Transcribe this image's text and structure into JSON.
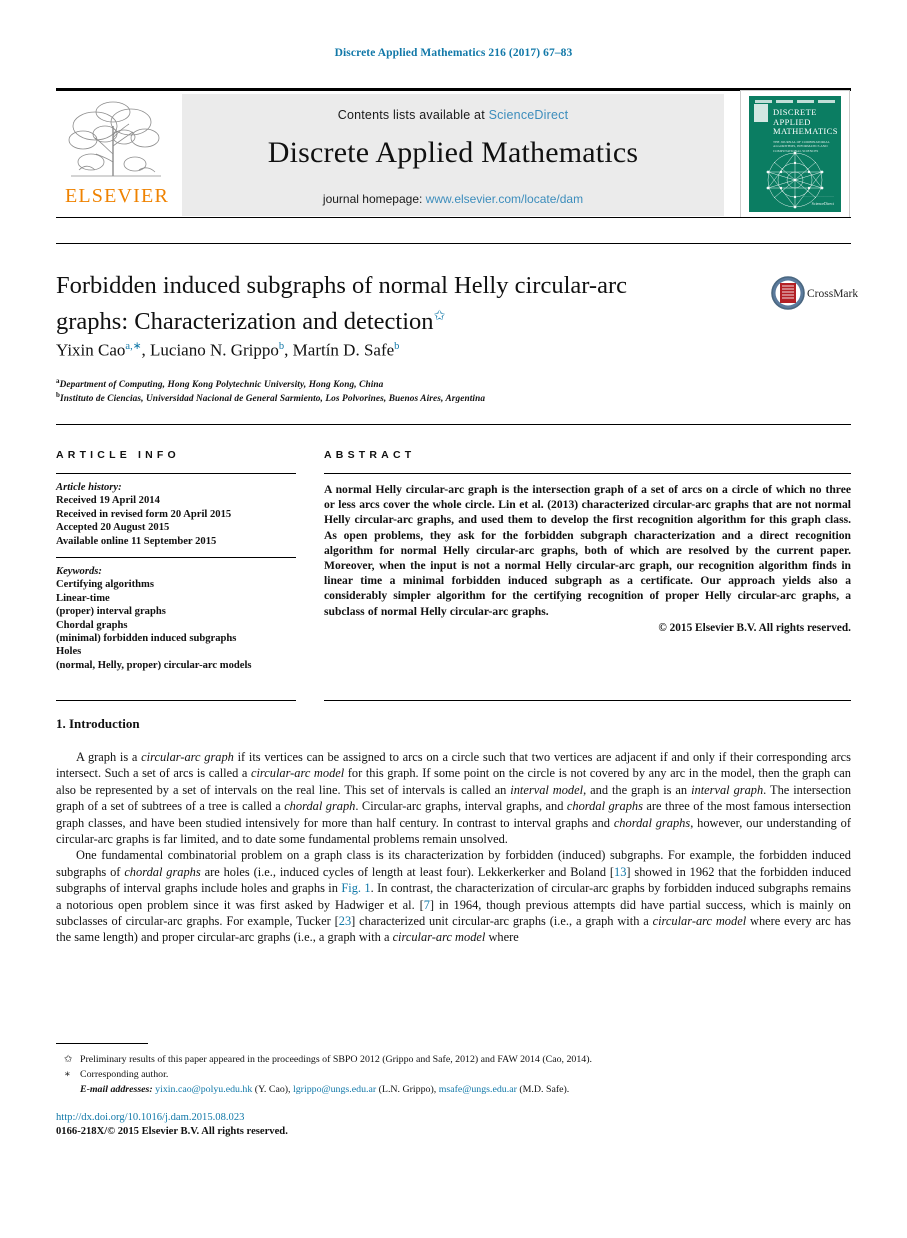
{
  "running_head": "Discrete Applied Mathematics 216 (2017) 67–83",
  "masthead": {
    "contents_prefix": "Contents lists available at",
    "contents_link": "ScienceDirect",
    "journal_title": "Discrete Applied Mathematics",
    "homepage_prefix": "journal homepage:",
    "homepage_url": "www.elsevier.com/locate/dam",
    "publisher_wordmark": "ELSEVIER",
    "cover": {
      "title_lines": [
        "DISCRETE",
        "APPLIED",
        "MATHEMATICS"
      ],
      "subtitle": "THE JOURNAL OF COMBINATORIAL ALGORITHMS, INFORMATICS AND COMPUTATIONAL SCIENCES",
      "footer": "ScienceDirect",
      "color": "#0b7d62"
    }
  },
  "article": {
    "title_line1": "Forbidden induced subgraphs of normal Helly circular-arc",
    "title_line2": "graphs: Characterization and detection",
    "title_marker": "✩",
    "crossmark_label": "CrossMark",
    "authors": [
      {
        "name": "Yixin Cao",
        "marks": "a,∗"
      },
      {
        "name": "Luciano N. Grippo",
        "marks": "b"
      },
      {
        "name": "Martín D. Safe",
        "marks": "b"
      }
    ],
    "affiliations": [
      {
        "mark": "a",
        "text": "Department of Computing, Hong Kong Polytechnic University, Hong Kong, China"
      },
      {
        "mark": "b",
        "text": "Instituto de Ciencias, Universidad Nacional de General Sarmiento, Los Polvorines, Buenos Aires, Argentina"
      }
    ]
  },
  "info": {
    "heading": "ARTICLE INFO",
    "history_label": "Article history:",
    "history": [
      "Received 19 April 2014",
      "Received in revised form 20 April 2015",
      "Accepted 20 August 2015",
      "Available online 11 September 2015"
    ],
    "keywords_label": "Keywords:",
    "keywords": [
      "Certifying algorithms",
      "Linear-time",
      "(proper) interval graphs",
      "Chordal graphs",
      "(minimal) forbidden induced subgraphs",
      "Holes",
      "(normal, Helly, proper) circular-arc models"
    ]
  },
  "abstract": {
    "heading": "ABSTRACT",
    "body": "A normal Helly circular-arc graph is the intersection graph of a set of arcs on a circle of which no three or less arcs cover the whole circle. Lin et al. (2013) characterized circular-arc graphs that are not normal Helly circular-arc graphs, and used them to develop the first recognition algorithm for this graph class. As open problems, they ask for the forbidden subgraph characterization and a direct recognition algorithm for normal Helly circular-arc graphs, both of which are resolved by the current paper. Moreover, when the input is not a normal Helly circular-arc graph, our recognition algorithm finds in linear time a minimal forbidden induced subgraph as a certificate. Our approach yields also a considerably simpler algorithm for the certifying recognition of proper Helly circular-arc graphs, a subclass of normal Helly circular-arc graphs.",
    "copyright": "© 2015 Elsevier B.V. All rights reserved."
  },
  "body": {
    "section_number": "1.",
    "section_title": "Introduction",
    "paragraphs": [
      "A graph is a circular-arc graph if its vertices can be assigned to arcs on a circle such that two vertices are adjacent if and only if their corresponding arcs intersect. Such a set of arcs is called a circular-arc model for this graph. If some point on the circle is not covered by any arc in the model, then the graph can also be represented by a set of intervals on the real line. This set of intervals is called an interval model, and the graph is an interval graph. The intersection graph of a set of subtrees of a tree is called a chordal graph. Circular-arc graphs, interval graphs, and chordal graphs are three of the most famous intersection graph classes, and have been studied intensively for more than half century. In contrast to interval graphs and chordal graphs, however, our understanding of circular-arc graphs is far limited, and to date some fundamental problems remain unsolved.",
      "One fundamental combinatorial problem on a graph class is its characterization by forbidden (induced) subgraphs. For example, the forbidden induced subgraphs of chordal graphs are holes (i.e., induced cycles of length at least four). Lekkerkerker and Boland [13] showed in 1962 that the forbidden induced subgraphs of interval graphs include holes and graphs in Fig. 1. In contrast, the characterization of circular-arc graphs by forbidden induced subgraphs remains a notorious open problem since it was first asked by Hadwiger et al. [7] in 1964, though previous attempts did have partial success, which is mainly on subclasses of circular-arc graphs. For example, Tucker [23] characterized unit circular-arc graphs (i.e., a graph with a circular-arc model where every arc has the same length) and proper circular-arc graphs (i.e., a graph with a circular-arc model where"
    ]
  },
  "footnotes": {
    "star_mark": "✩",
    "star_text": "Preliminary results of this paper appeared in the proceedings of SBPO 2012 (Grippo and Safe, 2012) and FAW 2014 (Cao, 2014).",
    "corr_mark": "∗",
    "corr_text": "Corresponding author.",
    "email_label": "E-mail addresses:",
    "emails": [
      {
        "address": "yixin.cao@polyu.edu.hk",
        "who": "(Y. Cao),"
      },
      {
        "address": "lgrippo@ungs.edu.ar",
        "who": "(L.N. Grippo),"
      },
      {
        "address": "msafe@ungs.edu.ar",
        "who": "(M.D. Safe)."
      }
    ],
    "doi": "http://dx.doi.org/10.1016/j.dam.2015.08.023",
    "issn": "0166-218X/© 2015 Elsevier B.V. All rights reserved."
  }
}
